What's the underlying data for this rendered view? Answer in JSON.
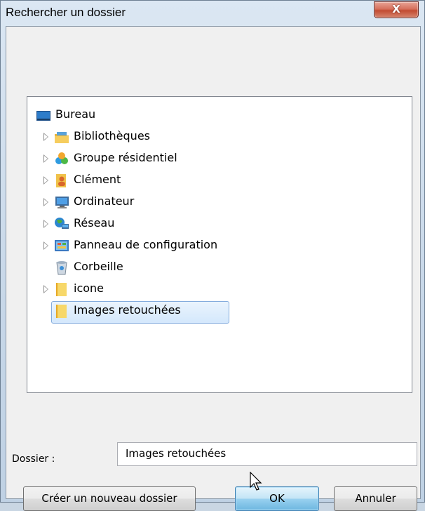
{
  "window": {
    "title": "Rechercher un dossier",
    "close_glyph": "X"
  },
  "tree": {
    "items": [
      {
        "label": "Bureau",
        "icon": "desktop-icon",
        "expandable": false,
        "selected": false
      },
      {
        "label": "Bibliothèques",
        "icon": "libraries-icon",
        "expandable": true,
        "selected": false
      },
      {
        "label": "Groupe résidentiel",
        "icon": "homegroup-icon",
        "expandable": true,
        "selected": false
      },
      {
        "label": "Clément",
        "icon": "user-folder-icon",
        "expandable": true,
        "selected": false
      },
      {
        "label": "Ordinateur",
        "icon": "computer-icon",
        "expandable": true,
        "selected": false
      },
      {
        "label": "Réseau",
        "icon": "network-icon",
        "expandable": true,
        "selected": false
      },
      {
        "label": "Panneau de configuration",
        "icon": "control-panel-icon",
        "expandable": true,
        "selected": false
      },
      {
        "label": "Corbeille",
        "icon": "recycle-bin-icon",
        "expandable": false,
        "selected": false
      },
      {
        "label": "icone",
        "icon": "folder-icon",
        "expandable": true,
        "selected": false
      },
      {
        "label": "Images retouchées",
        "icon": "folder-icon",
        "expandable": false,
        "selected": true
      }
    ]
  },
  "folder_field": {
    "label": "Dossier :",
    "value": "Images retouchées"
  },
  "buttons": {
    "new_folder": "Créer un nouveau dossier",
    "ok": "OK",
    "cancel": "Annuler"
  },
  "colors": {
    "selection_fill": "#d4e8fc",
    "selection_border": "#84acdd",
    "close_button": "#c24b31",
    "default_button": "#98d1ef"
  }
}
